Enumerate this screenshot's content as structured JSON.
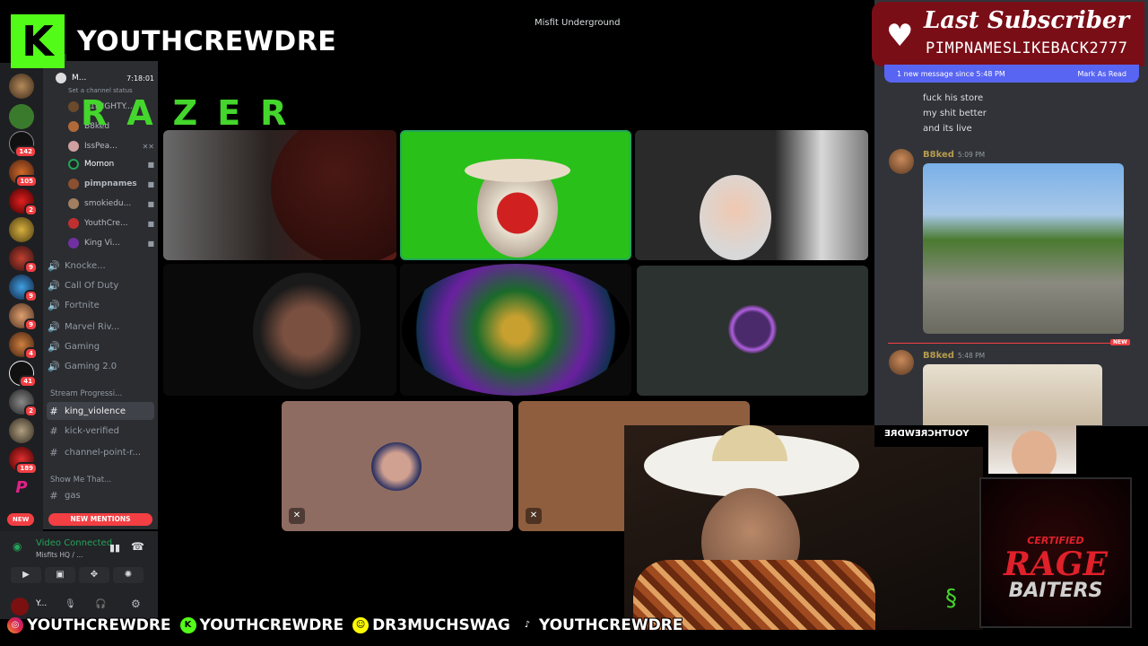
{
  "branding": {
    "kick_logo": "K",
    "channel_name": "YOUTHCREWDRE",
    "razer_text": "RAZER"
  },
  "topbar": {
    "title": "Misfit Underground"
  },
  "voice_users": [
    {
      "name": "M...",
      "time": "7:18:01"
    },
    {
      "name": "Set a channel status"
    },
    {
      "name": "A1MIGHTY..."
    },
    {
      "name": "B8ked"
    },
    {
      "name": "IssPea..."
    },
    {
      "name": "Momon"
    },
    {
      "name": "pimpnames"
    },
    {
      "name": "smokiedu..."
    },
    {
      "name": "YouthCre..."
    },
    {
      "name": "King Vi..."
    }
  ],
  "channels": [
    {
      "name": "Knocke..."
    },
    {
      "name": "Call Of Duty"
    },
    {
      "name": "Fortnite"
    },
    {
      "name": "Marvel Riv..."
    },
    {
      "name": "Gaming"
    },
    {
      "name": "Gaming 2.0"
    }
  ],
  "categories": {
    "stream": "Stream Progressi...",
    "show": "Show Me That..."
  },
  "text_channels": [
    {
      "name": "king_violence"
    },
    {
      "name": "kick-verified"
    },
    {
      "name": "channel-point-r..."
    },
    {
      "name": "gas"
    }
  ],
  "server_badges": [
    "142",
    "105",
    "2",
    "9",
    "9",
    "9",
    "4",
    "41",
    "2",
    "189"
  ],
  "new_pill": "NEW",
  "new_mentions": "NEW MENTIONS",
  "voice_panel": {
    "title": "Video Connected",
    "subtitle": "Misfits HQ / ...",
    "user": "Y..."
  },
  "subscriber": {
    "title": "Last Subscriber",
    "name": "PIMPNAMESLIKEBACK2777"
  },
  "chat": {
    "new_message_bar": "1 new message since 5:48 PM",
    "mark_read": "Mark As Read",
    "messages": [
      "fuck his store",
      "my shit better",
      "and its live"
    ],
    "authors": [
      {
        "name": "B8ked",
        "time": "5:09 PM"
      },
      {
        "name": "B8ked",
        "time": "5:48 PM"
      }
    ],
    "new_tag": "NEW"
  },
  "mirrored_text": "YOUTHCREWDRE",
  "rage": {
    "line1": "CERTIFIED",
    "line2": "RAGE",
    "line3": "BAITERS"
  },
  "socials": [
    {
      "icon": "instagram-icon",
      "handle": "YOUTHCREWDRE"
    },
    {
      "icon": "kick-icon",
      "handle": "YOUTHCREWDRE"
    },
    {
      "icon": "snapchat-icon",
      "handle": "DR3MUCHSWAG"
    },
    {
      "icon": "tiktok-icon",
      "handle": "YOUTHCREWDRE"
    }
  ],
  "colors": {
    "kick_green": "#53fc18",
    "razer_green": "#44d62c",
    "discord_bg": "#313338",
    "sidebar_bg": "#2b2d31",
    "mention_red": "#f23f43",
    "speaking_green": "#23a55a",
    "blurple": "#5865f2",
    "sub_banner": "#7a0e17"
  }
}
